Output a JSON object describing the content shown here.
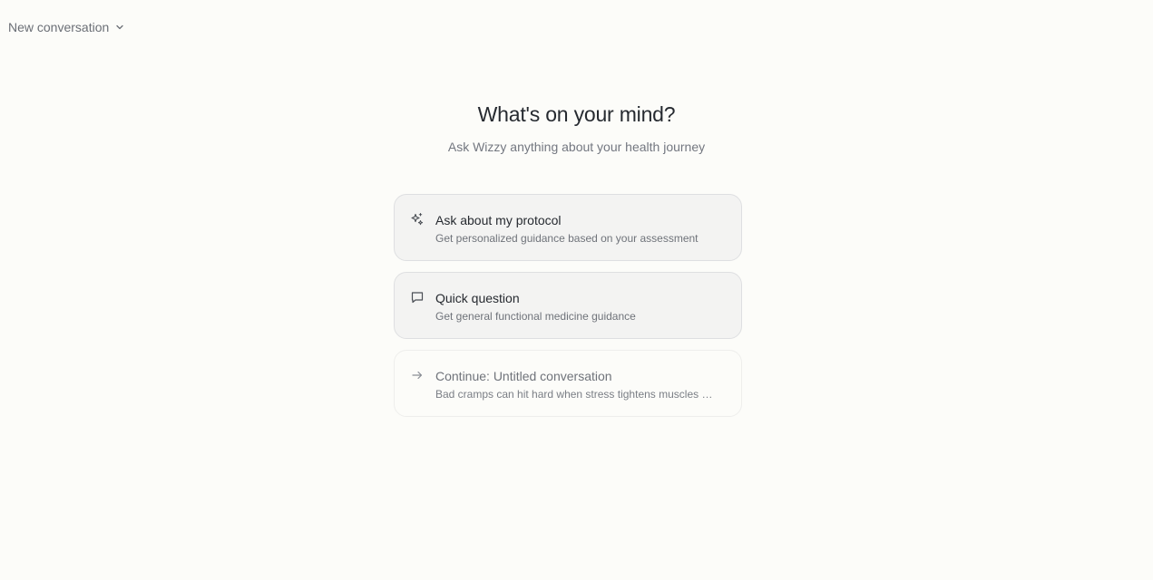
{
  "header": {
    "conversation_menu_label": "New conversation",
    "conversation_menu_icon": "chevron-down-icon"
  },
  "hero": {
    "title": "What's on your mind?",
    "subtitle": "Ask Wizzy anything about your health journey"
  },
  "options": [
    {
      "icon": "sparkles-icon",
      "title": "Ask about my protocol",
      "description": "Get personalized guidance based on your assessment"
    },
    {
      "icon": "chat-bubble-icon",
      "title": "Quick question",
      "description": "Get general functional medicine guidance"
    },
    {
      "icon": "arrow-right-icon",
      "title": "Continue: Untitled conversation",
      "description": "Bad cramps can hit hard when stress tightens muscles …"
    }
  ],
  "colors": {
    "background": "#fcfcf9",
    "card_background": "#f3f3f2",
    "card_border": "#dedfe1",
    "text_primary": "#262a30",
    "text_secondary": "#737780"
  }
}
